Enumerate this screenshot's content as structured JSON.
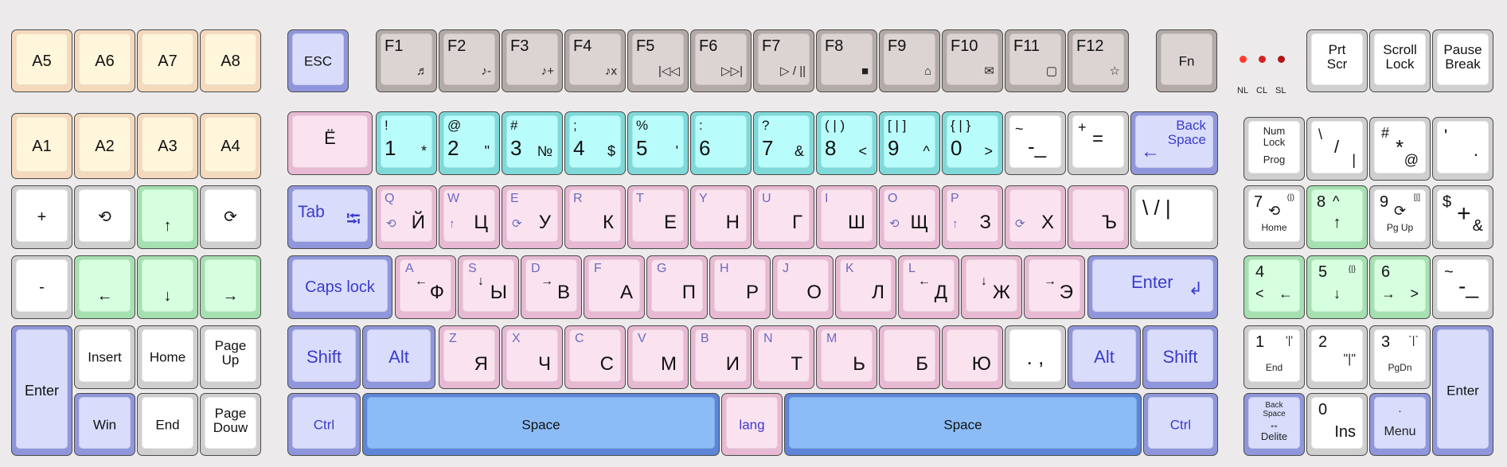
{
  "colors": {
    "led_nl": "#ff3b30",
    "led_cl": "#d42020",
    "led_sl": "#b21515"
  },
  "leds": {
    "nl": "NL",
    "cl": "CL",
    "sl": "SL"
  },
  "macro": {
    "a5": "A5",
    "a6": "A6",
    "a7": "A7",
    "a8": "A8",
    "a1": "A1",
    "a2": "A2",
    "a3": "A3",
    "a4": "A4"
  },
  "nav": {
    "plus": "+",
    "undo": "⟲",
    "up": "↑",
    "redo": "⟳",
    "minus": "-",
    "left": "←",
    "down": "↓",
    "right": "→",
    "enter": "Enter",
    "insert": "Insert",
    "home": "Home",
    "pageup_1": "Page",
    "pageup_2": "Up",
    "win": "Win",
    "end": "End",
    "pagedown_1": "Page",
    "pagedown_2": "Douw"
  },
  "top": {
    "esc": "ESC",
    "fn": "Fn",
    "prtscr_1": "Prt",
    "prtscr_2": "Scr",
    "scroll_1": "Scroll",
    "scroll_2": "Lock",
    "pause_1": "Pause",
    "pause_2": "Break"
  },
  "fkeys": [
    {
      "label": "F1",
      "sub": "♬"
    },
    {
      "label": "F2",
      "sub": "♪-"
    },
    {
      "label": "F3",
      "sub": "♪+"
    },
    {
      "label": "F4",
      "sub": "♪x"
    },
    {
      "label": "F5",
      "sub": "|◁◁"
    },
    {
      "label": "F6",
      "sub": "▷▷|"
    },
    {
      "label": "F7",
      "sub": "▷ / ||"
    },
    {
      "label": "F8",
      "sub": "■"
    },
    {
      "label": "F9",
      "sub": "⌂"
    },
    {
      "label": "F10",
      "sub": "✉"
    },
    {
      "label": "F11",
      "sub": "▢"
    },
    {
      "label": "F12",
      "sub": "☆"
    }
  ],
  "numrow": {
    "yo": "Ё",
    "keys": [
      {
        "top": "!",
        "main": "1",
        "alt": "*"
      },
      {
        "top": "@",
        "main": "2",
        "alt": "\""
      },
      {
        "top": "#",
        "main": "3",
        "alt": "№"
      },
      {
        "top": ";",
        "main": "4",
        "alt": "$"
      },
      {
        "top": "%",
        "main": "5",
        "alt": "'"
      },
      {
        "top": ":",
        "main": "6",
        "alt": ""
      },
      {
        "top": "?",
        "main": "7",
        "alt": "&"
      },
      {
        "top": "( | )",
        "main": "8",
        "alt": "<"
      },
      {
        "top": "[ | ]",
        "main": "9",
        "alt": "^"
      },
      {
        "top": "{ | }",
        "main": "0",
        "alt": ">"
      }
    ],
    "tilde_top": "~",
    "tilde_main": "-_",
    "plus_top": "+",
    "plus_main": "=",
    "backspace_1": "Back",
    "backspace_2": "Space",
    "backspace_arrow": "←"
  },
  "row_q": {
    "tab": "Tab",
    "tab_icon": "⭾",
    "keys": [
      {
        "lat": "Q",
        "cyr": "Й",
        "ico": "⟲"
      },
      {
        "lat": "W",
        "cyr": "Ц",
        "ico": "↑"
      },
      {
        "lat": "E",
        "cyr": "У",
        "ico": "⟳"
      },
      {
        "lat": "R",
        "cyr": "К",
        "ico": ""
      },
      {
        "lat": "T",
        "cyr": "Е",
        "ico": ""
      },
      {
        "lat": "Y",
        "cyr": "Н",
        "ico": ""
      },
      {
        "lat": "U",
        "cyr": "Г",
        "ico": ""
      },
      {
        "lat": "I",
        "cyr": "Ш",
        "ico": ""
      },
      {
        "lat": "O",
        "cyr": "Щ",
        "ico": "⟲"
      },
      {
        "lat": "P",
        "cyr": "З",
        "ico": "↑"
      },
      {
        "lat": "",
        "cyr": "Х",
        "ico": "⟳"
      },
      {
        "lat": "",
        "cyr": "Ъ",
        "ico": ""
      }
    ],
    "bslash": "\\  /  |"
  },
  "row_a": {
    "caps": "Caps lock",
    "keys": [
      {
        "lat": "A",
        "cyr": "Ф",
        "ico": "←"
      },
      {
        "lat": "S",
        "cyr": "Ы",
        "ico": "↓"
      },
      {
        "lat": "D",
        "cyr": "В",
        "ico": "→"
      },
      {
        "lat": "F",
        "cyr": "А",
        "ico": ""
      },
      {
        "lat": "G",
        "cyr": "П",
        "ico": ""
      },
      {
        "lat": "H",
        "cyr": "Р",
        "ico": ""
      },
      {
        "lat": "J",
        "cyr": "О",
        "ico": ""
      },
      {
        "lat": "K",
        "cyr": "Л",
        "ico": ""
      },
      {
        "lat": "L",
        "cyr": "Д",
        "ico": "←"
      },
      {
        "lat": "",
        "cyr": "Ж",
        "ico": "↓"
      },
      {
        "lat": "",
        "cyr": "Э",
        "ico": "→"
      }
    ],
    "enter": "Enter",
    "enter_icon": "↲"
  },
  "row_z": {
    "shift": "Shift",
    "alt": "Alt",
    "keys": [
      {
        "lat": "Z",
        "cyr": "Я"
      },
      {
        "lat": "X",
        "cyr": "Ч"
      },
      {
        "lat": "C",
        "cyr": "С"
      },
      {
        "lat": "V",
        "cyr": "М"
      },
      {
        "lat": "B",
        "cyr": "И"
      },
      {
        "lat": "N",
        "cyr": "Т"
      },
      {
        "lat": "M",
        "cyr": "Ь"
      },
      {
        "lat": "",
        "cyr": "Б"
      },
      {
        "lat": "",
        "cyr": "Ю"
      }
    ],
    "dot": ". ,",
    "alt_r": "Alt",
    "shift_r": "Shift"
  },
  "row_space": {
    "ctrl": "Ctrl",
    "space_l": "Space",
    "lang": "lang",
    "space_r": "Space",
    "ctrl_r": "Ctrl"
  },
  "numpad": {
    "numlock_1": "Num",
    "numlock_2": "Lock",
    "numlock_3": "Prog",
    "slash_a": "\\",
    "slash_b": "/",
    "slash_c": "|",
    "star_a": "#",
    "star_b": "*",
    "star_c": "@",
    "quote_a": "'",
    "quote_b": ".",
    "n7": "7",
    "n7_sym": "(|)",
    "n7_ico": "⟲",
    "n7_sub": "Home",
    "n8": "8",
    "n8_sym": "^",
    "n8_ico": "↑",
    "n9": "9",
    "n9_sym": "[|]",
    "n9_ico": "⟳",
    "n9_sub": "Pg Up",
    "plus_a": "$",
    "plus_b": "+",
    "plus_c": "&",
    "n4": "4",
    "n4_a": "<",
    "n4_b": "←",
    "n5": "5",
    "n5_sym": "{|}",
    "n5_b": "↓",
    "n6": "6",
    "n6_a": "→",
    "n6_b": ">",
    "minus_a": "~",
    "minus_b": "-_",
    "n1": "1",
    "n1_sym": "'|'",
    "n1_sub": "End",
    "n2": "2",
    "n2_sym": "\"|\"",
    "n3": "3",
    "n3_sym": "`|`",
    "n3_sub": "PgDn",
    "enter": "Enter",
    "bsdel_1": "Back",
    "bsdel_2": "Space",
    "bsdel_3": "↔",
    "bsdel_4": "Delite",
    "n0": "0",
    "n0_sub": "Ins",
    "menu_dot": "·",
    "menu": "Menu"
  }
}
